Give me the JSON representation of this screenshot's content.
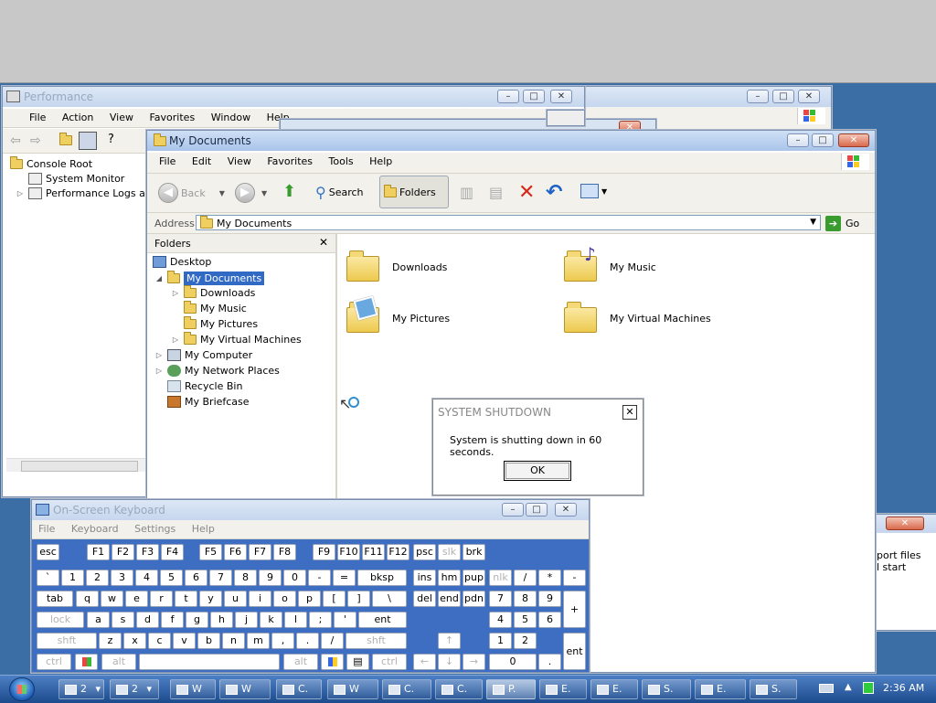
{
  "performance": {
    "title": "Performance",
    "menu": [
      "File",
      "Action",
      "View",
      "Favorites",
      "Window",
      "Help"
    ],
    "tree": [
      "Console Root",
      "System Monitor",
      "Performance Logs and"
    ]
  },
  "behind": {
    "text1": "port files",
    "text2": "l start"
  },
  "explorer": {
    "title": "My Documents",
    "menu": [
      "File",
      "Edit",
      "View",
      "Favorites",
      "Tools",
      "Help"
    ],
    "toolbar": {
      "back": "Back",
      "search": "Search",
      "folders": "Folders"
    },
    "address_label": "Address",
    "address_value": "My Documents",
    "go": "Go",
    "folders_pane_title": "Folders",
    "tree": {
      "desktop": "Desktop",
      "mydocs": "My Documents",
      "downloads": "Downloads",
      "music": "My Music",
      "pictures": "My Pictures",
      "vms": "My Virtual Machines",
      "computer": "My Computer",
      "network": "My Network Places",
      "recycle": "Recycle Bin",
      "briefcase": "My Briefcase"
    },
    "items": {
      "downloads": "Downloads",
      "music": "My Music",
      "pictures": "My Pictures",
      "vms": "My Virtual Machines"
    }
  },
  "dialog": {
    "title": "SYSTEM SHUTDOWN",
    "message": "System is shutting down in 60 seconds.",
    "ok": "OK"
  },
  "osk": {
    "title": "On-Screen Keyboard",
    "menu": [
      "File",
      "Keyboard",
      "Settings",
      "Help"
    ],
    "keys": {
      "esc": "esc",
      "f1": "F1",
      "f2": "F2",
      "f3": "F3",
      "f4": "F4",
      "f5": "F5",
      "f6": "F6",
      "f7": "F7",
      "f8": "F8",
      "f9": "F9",
      "f10": "F10",
      "f11": "F11",
      "f12": "F12",
      "psc": "psc",
      "slk": "slk",
      "brk": "brk",
      "grave": "`",
      "n1": "1",
      "n2": "2",
      "n3": "3",
      "n4": "4",
      "n5": "5",
      "n6": "6",
      "n7": "7",
      "n8": "8",
      "n9": "9",
      "n0": "0",
      "minus": "-",
      "equals": "=",
      "bksp": "bksp",
      "ins": "ins",
      "hm": "hm",
      "pup": "pup",
      "nlk": "nlk",
      "kpslash": "/",
      "kpstar": "*",
      "kpminus": "-",
      "tab": "tab",
      "q": "q",
      "w": "w",
      "e": "e",
      "r": "r",
      "t": "t",
      "y": "y",
      "u": "u",
      "i": "i",
      "o": "o",
      "p": "p",
      "lbr": "[",
      "rbr": "]",
      "bslash": "\\",
      "del": "del",
      "end": "end",
      "pdn": "pdn",
      "kp7": "7",
      "kp8": "8",
      "kp9": "9",
      "kpplus": "+",
      "lock": "lock",
      "a": "a",
      "s": "s",
      "d": "d",
      "f": "f",
      "g": "g",
      "h": "h",
      "j": "j",
      "k": "k",
      "l": "l",
      "semi": ";",
      "quote": "'",
      "ent": "ent",
      "kp4": "4",
      "kp5": "5",
      "kp6": "6",
      "shift": "shft",
      "z": "z",
      "x": "x",
      "c": "c",
      "v": "v",
      "b": "b",
      "n": "n",
      "m": "m",
      "comma": ",",
      "period": ".",
      "slash": "/",
      "shift2": "shft",
      "up": "↑",
      "kp1": "1",
      "kp2": "2",
      "ctrl": "ctrl",
      "alt": "alt",
      "alt2": "alt",
      "ctrl2": "ctrl",
      "left": "←",
      "down": "↓",
      "right": "→",
      "kp0": "0",
      "kpdot": ".",
      "kpent": "ent"
    }
  },
  "taskbar": {
    "buttons": [
      {
        "label": "2",
        "icon": "grid-icon"
      },
      {
        "label": "2",
        "icon": "window-icon"
      },
      {
        "label": "W",
        "icon": "word-icon"
      },
      {
        "label": "W",
        "icon": "window-icon"
      },
      {
        "label": "C.",
        "icon": "cmd-icon"
      },
      {
        "label": "W",
        "icon": "network-icon"
      },
      {
        "label": "C.",
        "icon": "explorer-icon"
      },
      {
        "label": "C.",
        "icon": "notepad-icon"
      },
      {
        "label": "P.",
        "icon": "perf-icon"
      },
      {
        "label": "E.",
        "icon": "cmd-icon"
      },
      {
        "label": "E.",
        "icon": "cmd-icon"
      },
      {
        "label": "S.",
        "icon": "window-icon"
      },
      {
        "label": "E.",
        "icon": "net-icon"
      },
      {
        "label": "S.",
        "icon": "service-icon"
      }
    ],
    "clock": "2:36 AM"
  }
}
